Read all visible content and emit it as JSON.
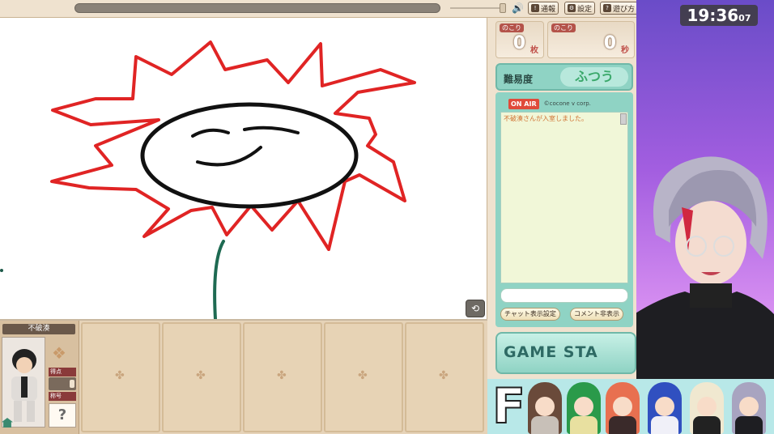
{
  "topbar": {
    "buttons": [
      {
        "icon": "report-icon",
        "label": "通報"
      },
      {
        "icon": "settings-icon",
        "label": "設定"
      },
      {
        "icon": "help-icon",
        "label": "遊び方"
      }
    ]
  },
  "counters": {
    "cards": {
      "label": "のこり",
      "value": "0",
      "unit": "枚"
    },
    "seconds": {
      "label": "のこり",
      "value": "0",
      "unit": "秒"
    }
  },
  "difficulty": {
    "label": "難易度",
    "value": "ふつう"
  },
  "chat": {
    "onair": "ON AIR",
    "copyright": "©cocone v corp.",
    "messages": [
      "不破湊さんが入室しました。"
    ],
    "input_value": "",
    "btn_settings": "チャット表示設定",
    "btn_hide": "コメント非表示"
  },
  "game_start": "GAME STA",
  "player": {
    "name": "不破湊",
    "score_label": "得点",
    "title_label": "称号",
    "title_value": "?"
  },
  "clock": {
    "hhmm": "19:36",
    "ss": "07"
  },
  "banner": {
    "letter": "F"
  },
  "colors": {
    "red_stroke": "#e02424",
    "black_stroke": "#111111",
    "stem": "#1e6a52",
    "accent_teal": "#8fd3c4"
  }
}
